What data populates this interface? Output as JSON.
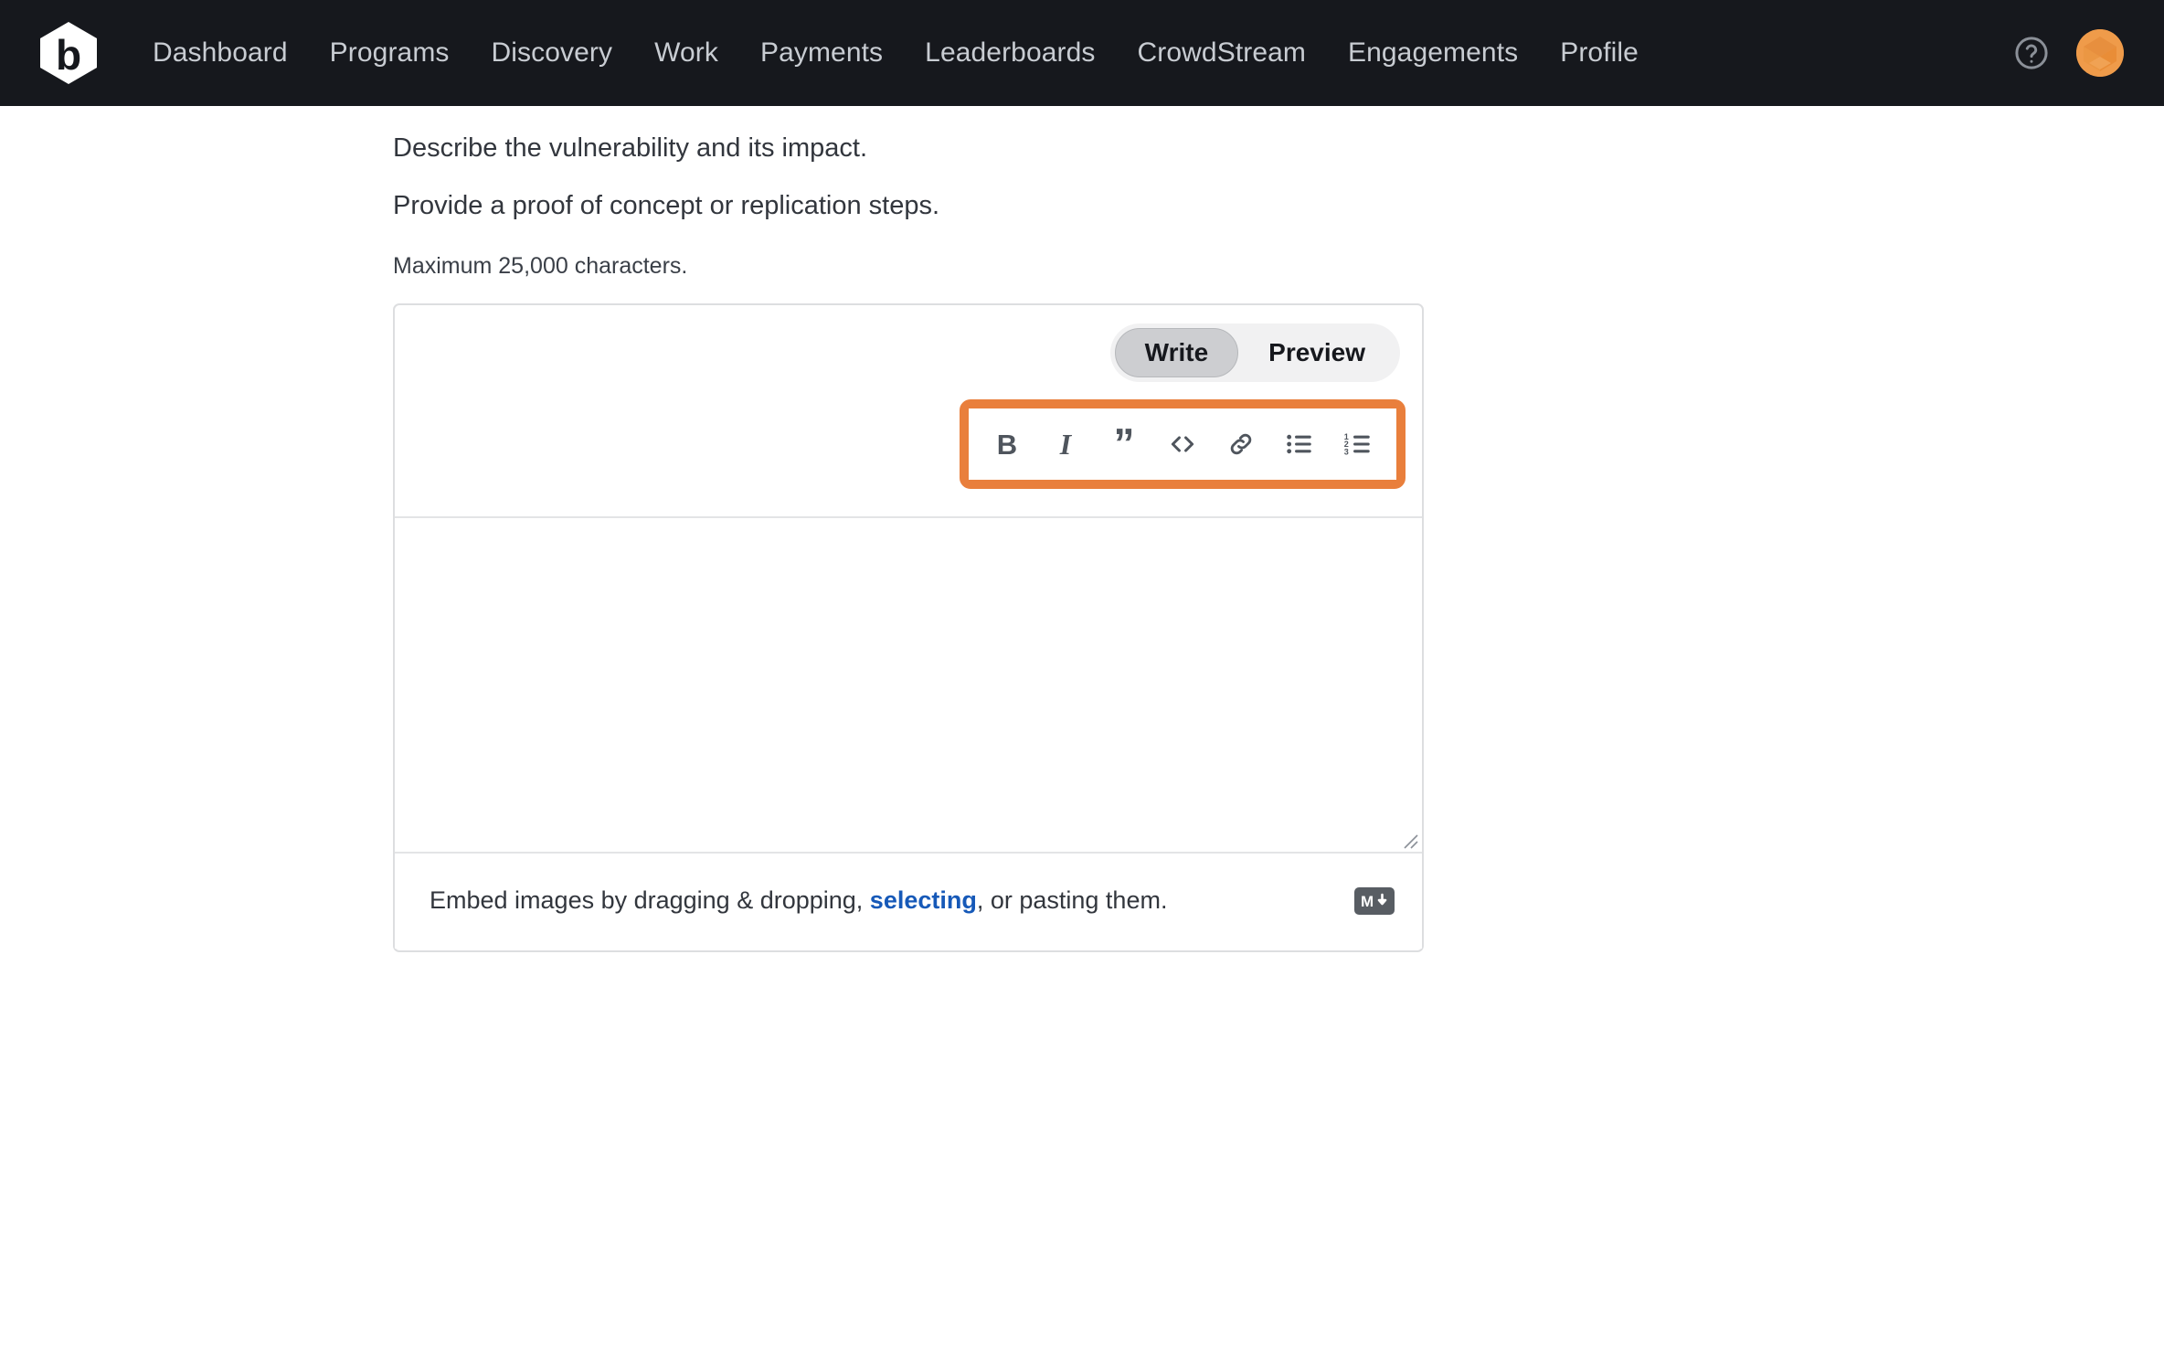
{
  "navbar": {
    "logo_name": "bugcrowd-hexagon-logo",
    "logo_letter": "b",
    "links": [
      {
        "label": "Dashboard",
        "name": "nav-link-dashboard"
      },
      {
        "label": "Programs",
        "name": "nav-link-programs"
      },
      {
        "label": "Discovery",
        "name": "nav-link-discovery"
      },
      {
        "label": "Work",
        "name": "nav-link-work"
      },
      {
        "label": "Payments",
        "name": "nav-link-payments"
      },
      {
        "label": "Leaderboards",
        "name": "nav-link-leaderboards"
      },
      {
        "label": "CrowdStream",
        "name": "nav-link-crowdstream"
      },
      {
        "label": "Engagements",
        "name": "nav-link-engagements"
      },
      {
        "label": "Profile",
        "name": "nav-link-profile"
      }
    ],
    "help_icon": "help-circle-icon",
    "avatar_icon": "user-avatar",
    "background_color": "#16181d",
    "link_color": "#c8ccd2",
    "avatar_color": "#ef9b4a"
  },
  "instructions": {
    "clipped_line": "",
    "line_1": "Describe the vulnerability and its impact.",
    "line_2": "Provide a proof of concept or replication steps.",
    "max_characters": "Maximum 25,000 characters."
  },
  "editor": {
    "modes": [
      {
        "label": "Write",
        "name": "tab-write",
        "active": true
      },
      {
        "label": "Preview",
        "name": "tab-preview",
        "active": false
      }
    ],
    "toolbar": {
      "highlight_color": "#e97f3c",
      "buttons": [
        {
          "label": "B",
          "name": "bold-icon",
          "title": "Bold"
        },
        {
          "label": "I",
          "name": "italic-icon",
          "title": "Italic"
        },
        {
          "label": "”",
          "name": "quote-icon",
          "title": "Quote"
        },
        {
          "label": "<>",
          "name": "code-icon",
          "title": "Code"
        },
        {
          "label": "",
          "name": "link-icon",
          "title": "Link"
        },
        {
          "label": "",
          "name": "unordered-list-icon",
          "title": "Bulleted list"
        },
        {
          "label": "",
          "name": "ordered-list-icon",
          "title": "Numbered list"
        }
      ]
    },
    "textarea": {
      "value": "",
      "placeholder": ""
    },
    "footer": {
      "text_before": "Embed images by dragging & dropping, ",
      "link_label": "selecting",
      "text_after": ", or pasting them.",
      "link_color": "#1659b8",
      "markdown_icon": "markdown-icon",
      "markdown_letter": "M"
    }
  }
}
